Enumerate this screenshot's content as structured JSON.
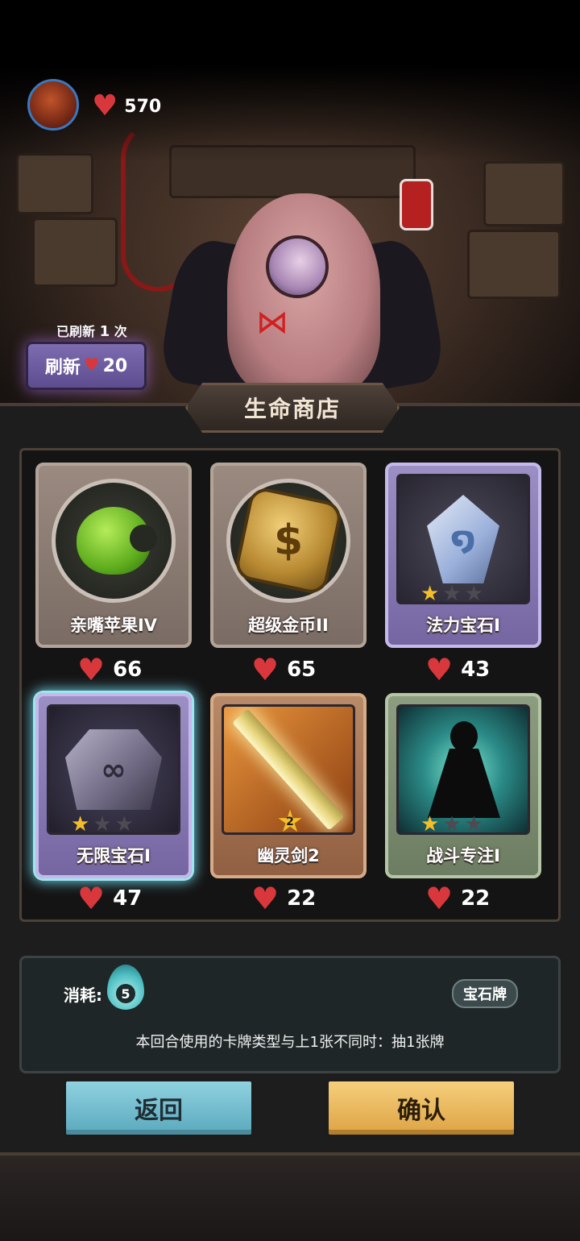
{
  "player": {
    "hp": "570"
  },
  "refresh": {
    "count_prefix": "已刷新",
    "count": "1",
    "count_suffix": "次",
    "label": "刷新",
    "cost": "20"
  },
  "shop": {
    "title": "生命商店",
    "items": [
      {
        "name": "亲嘴苹果IV",
        "price": "66",
        "frame": "gray",
        "icon": "apple-icon"
      },
      {
        "name": "超级金币II",
        "price": "65",
        "frame": "gray",
        "icon": "coin-icon"
      },
      {
        "name": "法力宝石I",
        "price": "43",
        "frame": "purple",
        "icon": "mana-gem-icon",
        "stars": 1
      },
      {
        "name": "无限宝石I",
        "price": "47",
        "frame": "purple",
        "icon": "infinity-gem-icon",
        "stars": 1,
        "selected": true
      },
      {
        "name": "幽灵剑2",
        "price": "22",
        "frame": "orange",
        "icon": "ghost-sword-icon",
        "level": "2"
      },
      {
        "name": "战斗专注I",
        "price": "22",
        "frame": "green",
        "icon": "meditation-icon",
        "stars": 1
      }
    ]
  },
  "detail": {
    "cost_label": "消耗:",
    "cost_value": "5",
    "tag": "宝石牌",
    "description": "本回合使用的卡牌类型与上1张不同时：抽1张牌"
  },
  "buttons": {
    "back": "返回",
    "confirm": "确认"
  },
  "colors": {
    "heart": "#d8383c",
    "back_button": "#7cc3d4",
    "confirm_button": "#f0bd5e",
    "star_on": "#f3be2a",
    "star_off": "#4d4a52"
  }
}
